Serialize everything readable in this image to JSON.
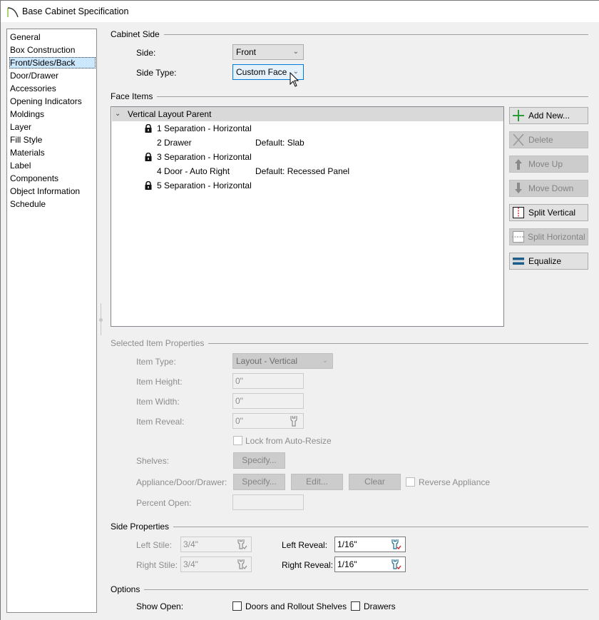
{
  "window": {
    "title": "Base Cabinet Specification"
  },
  "nav": {
    "items": [
      {
        "label": "General"
      },
      {
        "label": "Box Construction"
      },
      {
        "label": "Front/Sides/Back",
        "selected": true
      },
      {
        "label": "Door/Drawer"
      },
      {
        "label": "Accessories"
      },
      {
        "label": "Opening Indicators"
      },
      {
        "label": "Moldings"
      },
      {
        "label": "Layer"
      },
      {
        "label": "Fill Style"
      },
      {
        "label": "Materials"
      },
      {
        "label": "Label"
      },
      {
        "label": "Components"
      },
      {
        "label": "Object Information"
      },
      {
        "label": "Schedule"
      }
    ]
  },
  "cabinet_side": {
    "heading": "Cabinet Side",
    "side_label": "Side:",
    "side_value": "Front",
    "side_type_label": "Side Type:",
    "side_type_value": "Custom Face"
  },
  "face_items": {
    "heading": "Face Items",
    "tree": {
      "parent": "Vertical Layout Parent",
      "rows": [
        {
          "name": "1 Separation - Horizontal",
          "detail": "",
          "locked": true
        },
        {
          "name": "2 Drawer",
          "detail": "Default: Slab",
          "locked": false
        },
        {
          "name": "3 Separation - Horizontal",
          "detail": "",
          "locked": true
        },
        {
          "name": "4 Door - Auto Right",
          "detail": "Default: Recessed Panel",
          "locked": false
        },
        {
          "name": "5 Separation - Horizontal",
          "detail": "",
          "locked": true
        }
      ]
    },
    "buttons": {
      "add_new": "Add New...",
      "delete": "Delete",
      "move_up": "Move Up",
      "move_down": "Move Down",
      "split_vertical": "Split Vertical",
      "split_horizontal": "Split Horizontal",
      "equalize": "Equalize"
    }
  },
  "selected_item": {
    "heading": "Selected Item Properties",
    "item_type_label": "Item Type:",
    "item_type_value": "Layout - Vertical",
    "item_height_label": "Item Height:",
    "item_height_value": "0\"",
    "item_width_label": "Item Width:",
    "item_width_value": "0\"",
    "item_reveal_label": "Item Reveal:",
    "item_reveal_value": "0\"",
    "lock_auto_resize": "Lock from Auto-Resize",
    "shelves_label": "Shelves:",
    "specify": "Specify...",
    "appliance_label": "Appliance/Door/Drawer:",
    "edit": "Edit...",
    "clear": "Clear",
    "reverse_appliance": "Reverse Appliance",
    "percent_open_label": "Percent Open:",
    "percent_open_value": ""
  },
  "side_properties": {
    "heading": "Side Properties",
    "left_stile_label": "Left Stile:",
    "left_stile_value": "3/4\"",
    "right_stile_label": "Right Stile:",
    "right_stile_value": "3/4\"",
    "left_reveal_label": "Left Reveal:",
    "left_reveal_value": "1/16\"",
    "right_reveal_label": "Right Reveal:",
    "right_reveal_value": "1/16\""
  },
  "options": {
    "heading": "Options",
    "show_open_label": "Show Open:",
    "doors_rollout": "Doors and Rollout Shelves",
    "drawers": "Drawers"
  }
}
